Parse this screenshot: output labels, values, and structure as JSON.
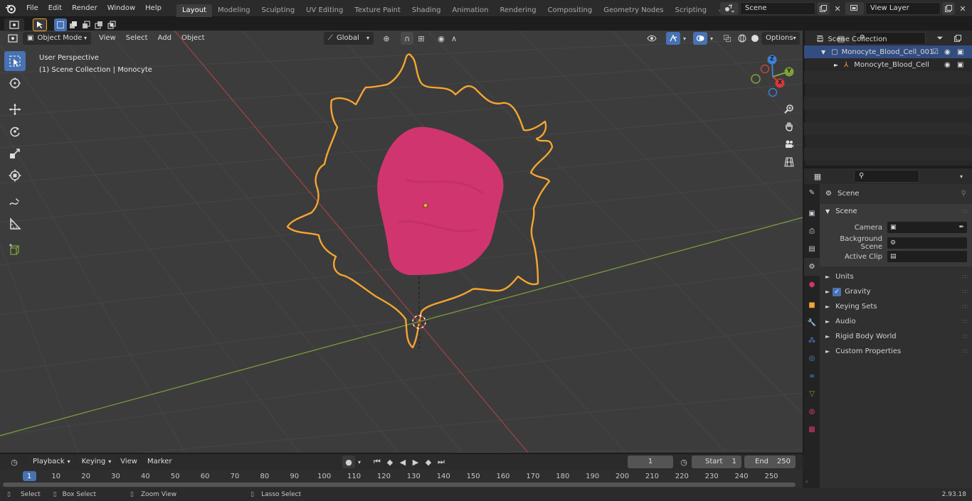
{
  "topbar": {
    "menus": [
      "File",
      "Edit",
      "Render",
      "Window",
      "Help"
    ],
    "workspaces": [
      "Layout",
      "Modeling",
      "Sculpting",
      "UV Editing",
      "Texture Paint",
      "Shading",
      "Animation",
      "Rendering",
      "Compositing",
      "Geometry Nodes",
      "Scripting"
    ],
    "active_workspace": "Layout",
    "add_tab": "+",
    "scene_name": "Scene",
    "view_layer": "View Layer"
  },
  "viewport_header": {
    "mode": "Object Mode",
    "menus": [
      "View",
      "Select",
      "Add",
      "Object"
    ],
    "transform_orientation": "Global",
    "options_label": "Options"
  },
  "viewport": {
    "perspective_label": "User Perspective",
    "collection_label": "(1) Scene Collection | Monocyte",
    "gizmo": {
      "x": "X",
      "y": "Y",
      "z": "Z"
    }
  },
  "outliner": {
    "root": "Scene Collection",
    "items": [
      {
        "label": "Monocyte_Blood_Cell_001",
        "level": 1
      },
      {
        "label": "Monocyte_Blood_Cell",
        "level": 2
      }
    ]
  },
  "properties": {
    "context_title": "Scene",
    "panel_title": "Scene",
    "fields": [
      {
        "label": "Camera"
      },
      {
        "label": "Background Scene"
      },
      {
        "label": "Active Clip"
      }
    ],
    "subpanels": [
      {
        "label": "Units",
        "checkbox": false
      },
      {
        "label": "Gravity",
        "checkbox": true
      },
      {
        "label": "Keying Sets",
        "checkbox": false
      },
      {
        "label": "Audio",
        "checkbox": false
      },
      {
        "label": "Rigid Body World",
        "checkbox": false
      },
      {
        "label": "Custom Properties",
        "checkbox": false
      }
    ]
  },
  "timeline": {
    "menus": [
      "Playback",
      "Keying",
      "View",
      "Marker"
    ],
    "current_frame": "1",
    "start_label": "Start",
    "start_value": "1",
    "end_label": "End",
    "end_value": "250",
    "ruler": [
      "1",
      "10",
      "20",
      "30",
      "40",
      "50",
      "60",
      "70",
      "80",
      "90",
      "100",
      "110",
      "120",
      "130",
      "140",
      "150",
      "160",
      "170",
      "180",
      "190",
      "200",
      "210",
      "220",
      "230",
      "240",
      "250"
    ]
  },
  "statusbar": {
    "items": [
      "Select",
      "Box Select",
      "Zoom View",
      "Lasso Select"
    ],
    "version": "2.93.18"
  },
  "colors": {
    "accent": "#4772b3",
    "selection_outline": "#f5a531",
    "cell_nucleus": "#d1356f",
    "x_axis": "#b64444",
    "y_axis": "#7ea23a"
  }
}
